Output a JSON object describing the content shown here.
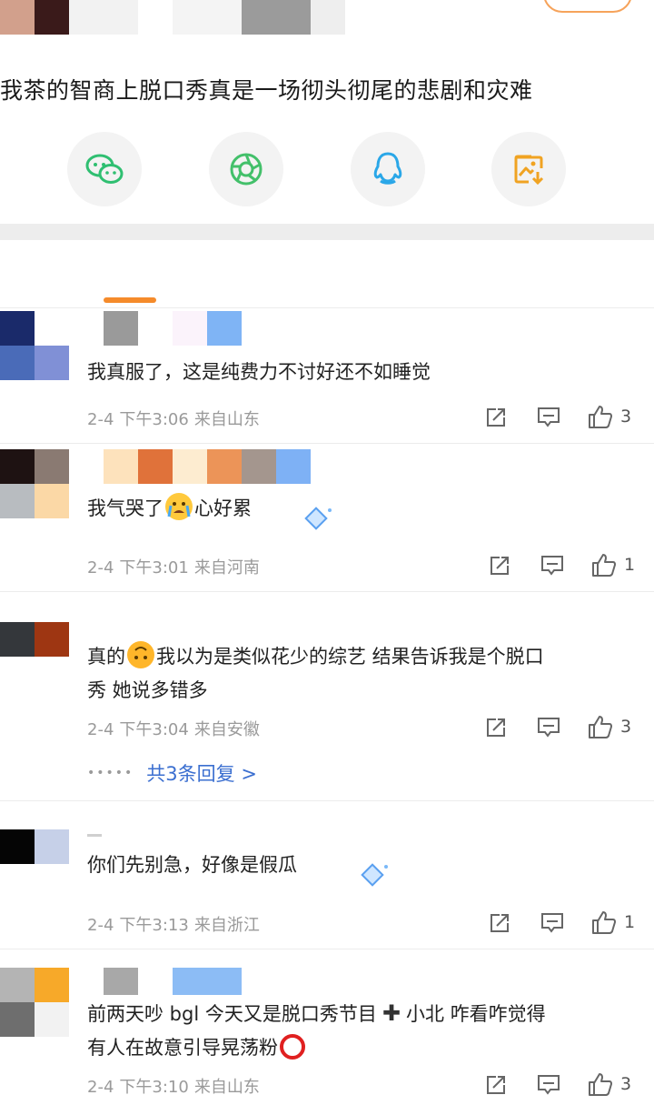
{
  "post": {
    "text": "我茶的智商上脱口秀真是一场彻头彻尾的悲剧和灾难"
  },
  "share": {
    "items": [
      {
        "name": "wechat",
        "icon": "wechat-icon"
      },
      {
        "name": "moments",
        "icon": "aperture-icon"
      },
      {
        "name": "qq",
        "icon": "qq-penguin-icon"
      },
      {
        "name": "save-image",
        "icon": "image-save-icon"
      }
    ]
  },
  "colors": {
    "accent": "#f58b2b",
    "link": "#3b6fd0",
    "meta": "#9a9a9a"
  },
  "comments": [
    {
      "text": "我真服了，这是纯费力不讨好还不如睡觉",
      "date": "2-4",
      "time": "下午3:06",
      "location": "来自山东",
      "likes": "3"
    },
    {
      "text_before": "我气哭了",
      "emoji": "crying-face-icon",
      "text_after": "心好累",
      "date": "2-4",
      "time": "下午3:01",
      "location": "来自河南",
      "likes": "1"
    },
    {
      "text_prefix": "真的",
      "emoji": "upside-down-face-icon",
      "text_line1": "我以为是类似花少的综艺 结果告诉我是个脱口",
      "text_line2": "秀 她说多错多",
      "date": "2-4",
      "time": "下午3:04",
      "location": "来自安徽",
      "likes": "3",
      "replies_label": "共3条回复 >"
    },
    {
      "text": "你们先别急，好像是假瓜",
      "date": "2-4",
      "time": "下午3:13",
      "location": "来自浙江",
      "likes": "1"
    },
    {
      "text_line1_a": "前两天吵 bgl 今天又是脱口秀节目",
      "text_line1_b": "小北 咋看咋觉得",
      "text_line2": "有人在故意引导晃荡粉",
      "emoji_plus": "heavy-plus-icon",
      "emoji_ring": "hollow-red-circle-icon",
      "date": "2-4",
      "time": "下午3:10",
      "location": "来自山东",
      "likes": "3"
    }
  ]
}
